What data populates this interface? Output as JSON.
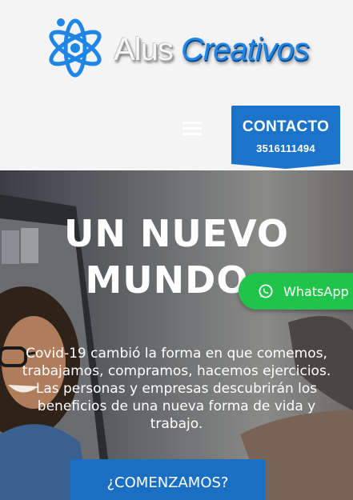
{
  "header": {
    "logo": {
      "word1": "Alus",
      "word2": "Creativos"
    },
    "contact": {
      "title": "CONTACTO",
      "phone": "3516111494"
    }
  },
  "hero": {
    "title_line1": "UN NUEVO",
    "title_line2": "MUNDO",
    "text_line1": "Covid-19 cambió la forma en que comemos,",
    "text_line2": "trabajamos, compramos, hacemos ejercicios.",
    "text_line3": "Las personas y empresas descubrirán los",
    "text_line4": "beneficios de una nueva forma de vida y trabajo.",
    "cta_label": "¿COMENZAMOS?"
  },
  "whatsapp": {
    "label": "WhatsApp"
  },
  "colors": {
    "brand_blue": "#1b74c9",
    "logo_blue": "#1f86e6",
    "whatsapp_green": "#22c34a"
  }
}
